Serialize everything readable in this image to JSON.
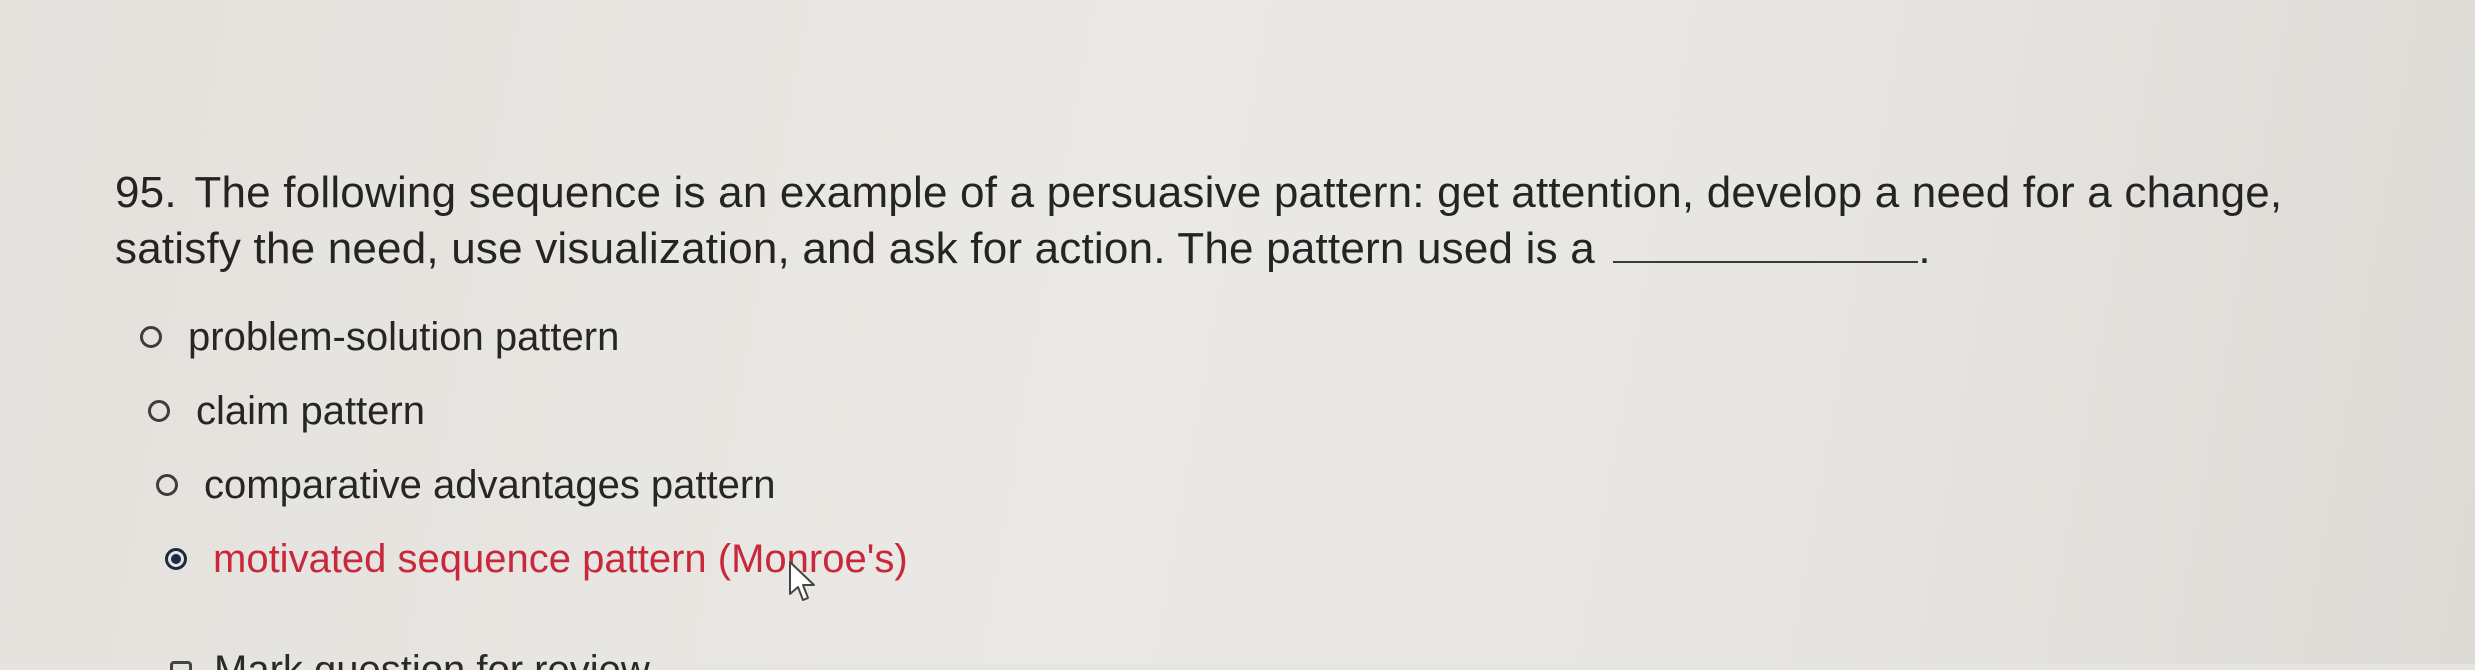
{
  "question": {
    "number": "95.",
    "text": "The following sequence is an example of a persuasive pattern: get attention, develop a need for a change, satisfy the need, use visualization, and ask for action. The pattern used is a",
    "end_punctuation": "."
  },
  "options": [
    {
      "label": "problem-solution pattern",
      "selected": false
    },
    {
      "label": "claim pattern",
      "selected": false
    },
    {
      "label": "comparative advantages pattern",
      "selected": false
    },
    {
      "label": "motivated sequence pattern (Monroe's)",
      "selected": true
    }
  ],
  "next_item_partial": "Mark question for review",
  "colors": {
    "selected_text": "#c8283a",
    "radio_checked": "#1b2a44",
    "background": "#e7e5e1"
  },
  "icons": {
    "cursor": "arrow-cursor-icon"
  }
}
